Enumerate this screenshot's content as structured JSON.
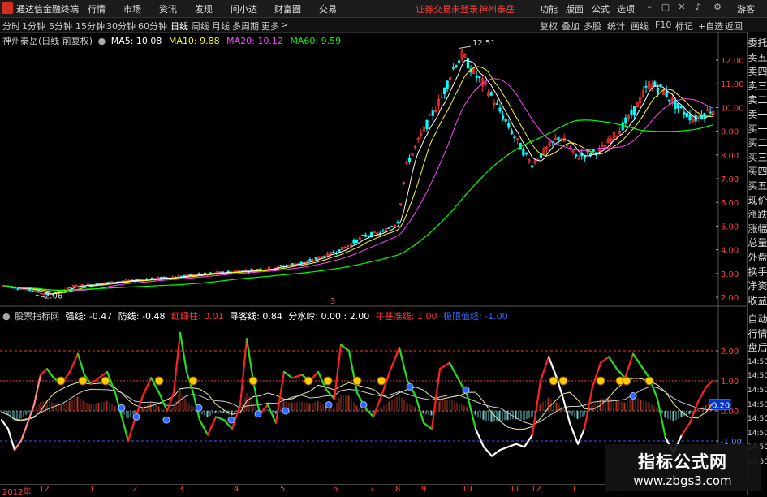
{
  "menubar": {
    "app_name": "通达信金融终端",
    "items": [
      "行情",
      "市场",
      "资讯",
      "发现",
      "问小达",
      "财富圈",
      "交易"
    ],
    "alert": "证券交易未登录",
    "stock": "神州泰岳",
    "right_items": [
      "功能",
      "版面",
      "公式",
      "选项"
    ],
    "guest": "游客"
  },
  "toolbar": {
    "periods": [
      "分时",
      "1分钟",
      "5分钟",
      "15分钟",
      "30分钟",
      "60分钟",
      "日线",
      "周线",
      "月线",
      "多周期",
      "更多"
    ],
    "active": "日线",
    "right": [
      "复权",
      "叠加",
      "多股",
      "统计",
      "画线",
      "F10",
      "标记",
      "+自选",
      "返回"
    ]
  },
  "main_chart": {
    "title": "神州泰岳(日线 前复权)",
    "ma": [
      {
        "label": "MA5: 10.08",
        "color": "#ffffff"
      },
      {
        "label": "MA10: 9.88",
        "color": "#ffff00"
      },
      {
        "label": "MA20: 10.12",
        "color": "#ff44ff"
      },
      {
        "label": "MA60: 9.59",
        "color": "#00ff00"
      }
    ],
    "high_label": "12.51",
    "low_label": "2.06",
    "yticks": [
      "12.00",
      "11.00",
      "10.00",
      "9.00",
      "8.00",
      "7.00",
      "6.00",
      "5.00",
      "4.00",
      "3.00",
      "2.00"
    ],
    "marker": "3"
  },
  "indicator": {
    "title": "股票指标网",
    "items": [
      {
        "label": "强线: -0.47",
        "color": "#ffffff"
      },
      {
        "label": "防线: -0.48",
        "color": "#ffffff"
      },
      {
        "label": "红绿柱: 0.01",
        "color": "#ff3333"
      },
      {
        "label": "寻客线: 0.84",
        "color": "#ffffff"
      },
      {
        "label": "分水岭: 0.00 : 2.00",
        "color": "#ffffff"
      },
      {
        "label": "牛基准线: 1.00",
        "color": "#ff3333"
      },
      {
        "label": "极限值线: -1.00",
        "color": "#3366ff"
      }
    ],
    "yticks": [
      "2.00",
      "1.00",
      "0.20",
      "0.00",
      "-1.00"
    ],
    "current_value": "0.20"
  },
  "bottom_axis": {
    "labels": [
      "2012年",
      "12",
      "1",
      "2",
      "3",
      "4",
      "5",
      "6",
      "7",
      "8",
      "9",
      "10",
      "11",
      "12",
      "1",
      "2"
    ]
  },
  "side_panel": {
    "top": [
      "委托",
      "卖五",
      "卖四",
      "卖三",
      "卖二",
      "卖一",
      "买一",
      "买二",
      "买三",
      "买四",
      "买五",
      "现价",
      "涨跌",
      "涨幅",
      "总量",
      "外盘",
      "换手",
      "净资",
      "收益"
    ],
    "bottom": [
      "自动",
      "行情",
      "盘后",
      "14:50",
      "14:50",
      "14:50",
      "14:50",
      "14:50",
      "14:50",
      "14:50",
      "14:50"
    ]
  },
  "watermark": {
    "title": "指标公式网",
    "url": "www.zbgs3.com"
  },
  "colors": {
    "up": "#ff3333",
    "down": "#00ffff",
    "ma5": "#ffffff",
    "ma10": "#ffff00",
    "ma20": "#ff44ff",
    "ma60": "#00ff00"
  }
}
